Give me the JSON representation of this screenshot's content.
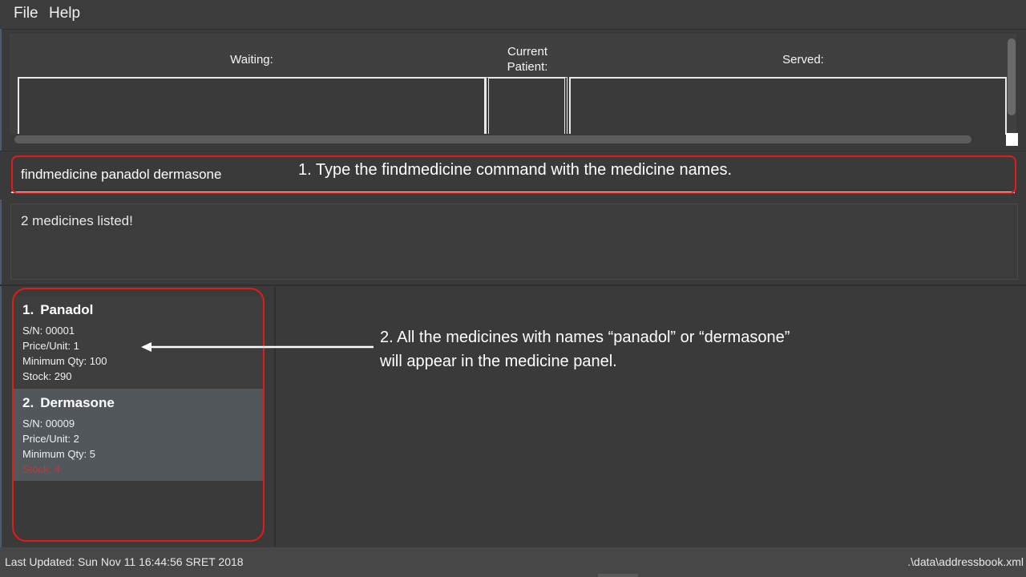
{
  "menu": {
    "file": "File",
    "help": "Help"
  },
  "queue": {
    "waiting": "Waiting:",
    "current": "Current\nPatient:",
    "served": "Served:"
  },
  "command": {
    "value": "findmedicine panadol dermasone",
    "annotation": "1. Type the findmedicine command with the medicine names."
  },
  "result": {
    "text": "2 medicines listed!"
  },
  "medicines": [
    {
      "index": "1.",
      "name": "Panadol",
      "sn": "S/N: 00001",
      "price": "Price/Unit: 1",
      "min_qty": "Minimum Qty: 100",
      "stock": "Stock: 290",
      "low_stock": false
    },
    {
      "index": "2.",
      "name": "Dermasone",
      "sn": "S/N: 00009",
      "price": "Price/Unit: 2",
      "min_qty": "Minimum Qty: 5",
      "stock": "Stock: 4",
      "low_stock": true
    }
  ],
  "annotation2": {
    "line1": "2. All the medicines with names “panadol” or “dermasone”",
    "line2": "will appear in the medicine panel."
  },
  "status": {
    "last_updated": "Last Updated: Sun Nov 11 16:44:56 SRET 2018",
    "file_path": ".\\data\\addressbook.xml"
  },
  "colors": {
    "highlight": "#e21b1b",
    "low_stock": "#cc3333",
    "selected_card": "#51575b"
  }
}
